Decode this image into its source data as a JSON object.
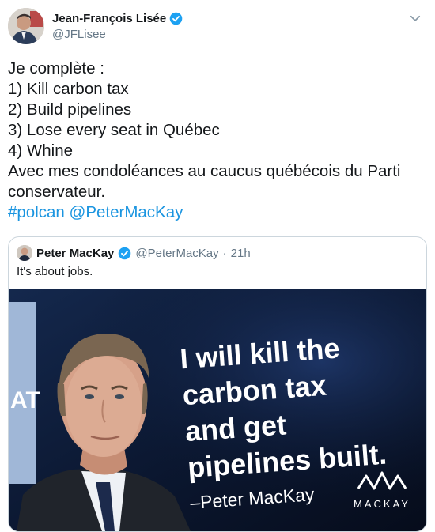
{
  "author": {
    "name": "Jean-François Lisée",
    "handle": "@JFLisee"
  },
  "tweet": {
    "lines": [
      "Je complète :",
      "1) Kill carbon tax",
      "2) Build pipelines",
      "3) Lose every seat in Québec",
      "4) Whine",
      "Avec mes condoléances au caucus québécois du Parti",
      "conservateur."
    ],
    "hashtag": "#polcan",
    "mention": "@PeterMacKay"
  },
  "quoted": {
    "name": "Peter MacKay",
    "handle": "@PeterMacKay",
    "separator": "·",
    "time": "21h",
    "text": "It's about jobs.",
    "image": {
      "headline_lines": [
        "I will kill the",
        "carbon tax",
        "and get",
        "pipelines built."
      ],
      "attribution": "–Peter MacKay",
      "brand": "MACKAY"
    }
  },
  "colors": {
    "verified": "#1da1f2",
    "link": "#1b95e0",
    "image_bg": "#0b1730"
  },
  "icons": [
    "verified-badge-icon",
    "chevron-down-icon"
  ]
}
